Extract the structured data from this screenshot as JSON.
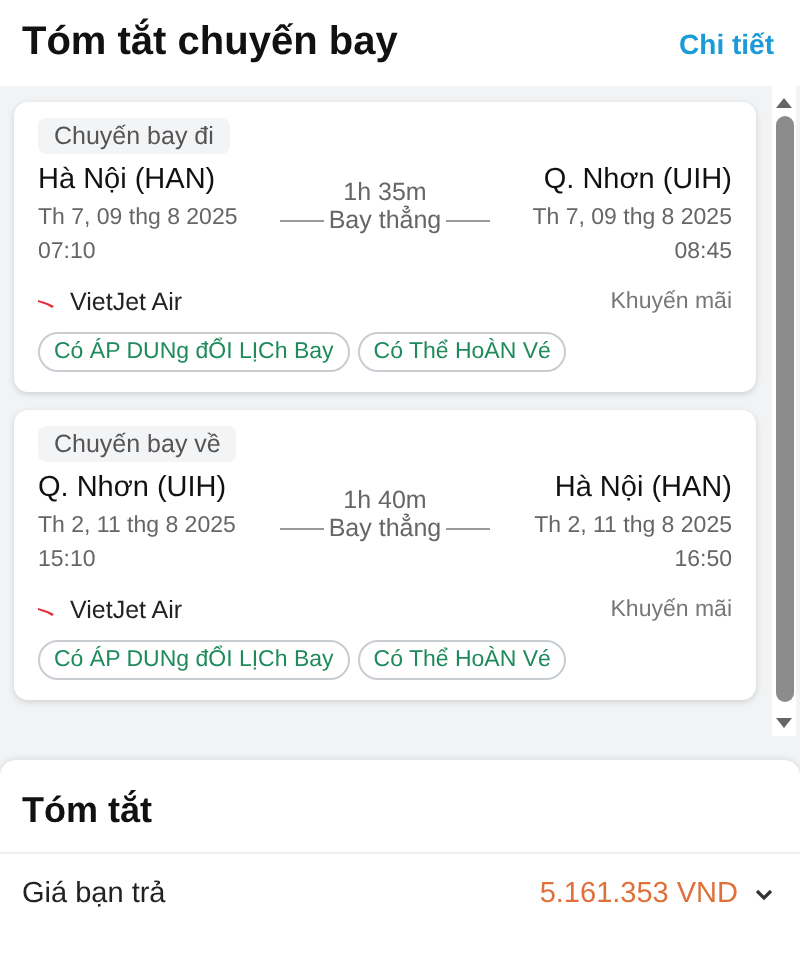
{
  "header": {
    "title": "Tóm tắt chuyến bay",
    "link": "Chi tiết"
  },
  "flights": [
    {
      "label": "Chuyến bay đi",
      "from": {
        "city": "Hà Nội (HAN)",
        "date": "Th 7, 09 thg 8 2025",
        "time": "07:10"
      },
      "duration": "1h 35m",
      "stops": "Bay thẳng",
      "to": {
        "city": "Q. Nhơn (UIH)",
        "date": "Th 7, 09 thg 8 2025",
        "time": "08:45"
      },
      "airline": "VietJet Air",
      "fare": "Khuyến mãi",
      "tags": [
        "Có ÁP DUNg đỔI LỊCh Bay",
        "Có Thể HoÀN Vé"
      ]
    },
    {
      "label": "Chuyến bay về",
      "from": {
        "city": "Q. Nhơn (UIH)",
        "date": "Th 2, 11 thg 8 2025",
        "time": "15:10"
      },
      "duration": "1h 40m",
      "stops": "Bay thẳng",
      "to": {
        "city": "Hà Nội (HAN)",
        "date": "Th 2, 11 thg 8 2025",
        "time": "16:50"
      },
      "airline": "VietJet Air",
      "fare": "Khuyến mãi",
      "tags": [
        "Có ÁP DUNg đỔI LỊCh Bay",
        "Có Thể HoÀN Vé"
      ]
    }
  ],
  "summary": {
    "title": "Tóm tắt",
    "price_label": "Giá bạn trả",
    "price": "5.161.353 VND",
    "expanded": false
  }
}
